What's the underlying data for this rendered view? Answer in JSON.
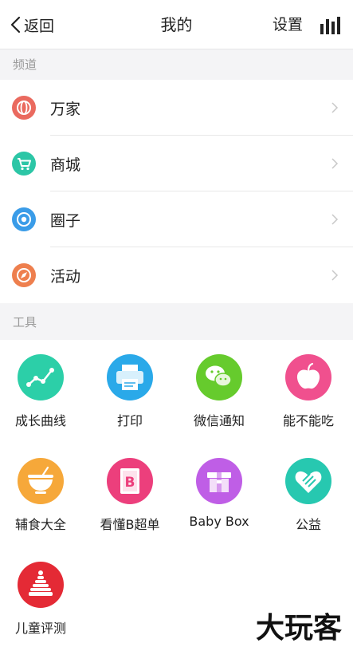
{
  "header": {
    "back_label": "返回",
    "title": "我的",
    "settings_label": "设置",
    "stats_icon": "bar-chart-icon"
  },
  "channels_section": {
    "title": "频道",
    "items": [
      {
        "label": "万家",
        "icon": "globe-icon",
        "color": "#ea6a5f"
      },
      {
        "label": "商城",
        "icon": "cart-icon",
        "color": "#2cc6a6"
      },
      {
        "label": "圈子",
        "icon": "target-icon",
        "color": "#3a9ce8"
      },
      {
        "label": "活动",
        "icon": "compass-icon",
        "color": "#ee7f4e"
      }
    ]
  },
  "tools_section": {
    "title": "工具",
    "items": [
      {
        "label": "成长曲线",
        "icon": "growth-curve-icon",
        "color": "#2ccfa8"
      },
      {
        "label": "打印",
        "icon": "printer-icon",
        "color": "#2aa9e9"
      },
      {
        "label": "微信通知",
        "icon": "wechat-icon",
        "color": "#66cb2d"
      },
      {
        "label": "能不能吃",
        "icon": "apple-icon",
        "color": "#f0508e"
      },
      {
        "label": "辅食大全",
        "icon": "food-bowl-icon",
        "color": "#f6a83a"
      },
      {
        "label": "看懂B超单",
        "icon": "b-ultrasound-icon",
        "color": "#ec3f7c"
      },
      {
        "label": "Baby Box",
        "icon": "gift-box-icon",
        "color": "#bf5ee6"
      },
      {
        "label": "公益",
        "icon": "heart-hands-icon",
        "color": "#27c8b0"
      },
      {
        "label": "儿童评测",
        "icon": "stacking-rings-icon",
        "color": "#e42a35"
      }
    ]
  },
  "watermark": {
    "text": "大玩客"
  }
}
